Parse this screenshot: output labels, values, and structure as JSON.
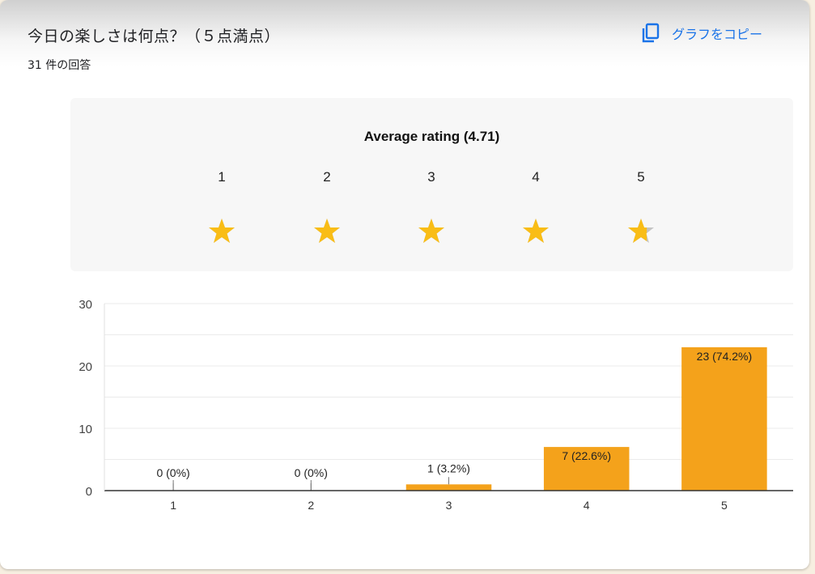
{
  "header": {
    "title": "今日の楽しさは何点？（５点満点）",
    "response_count": "31 件の回答",
    "copy_label": "グラフをコピー"
  },
  "rating": {
    "average_label": "Average rating (4.71)",
    "average_value": 4.71,
    "stars": [
      {
        "label": "1",
        "fill": 1
      },
      {
        "label": "2",
        "fill": 1
      },
      {
        "label": "3",
        "fill": 1
      },
      {
        "label": "4",
        "fill": 1
      },
      {
        "label": "5",
        "fill": 0.71
      }
    ]
  },
  "colors": {
    "star_filled": "#f9bd16",
    "star_empty": "#c4c4c4",
    "bar": "#f4a21b",
    "accent": "#1a73e8"
  },
  "icons": {
    "copy": "copy-icon",
    "star": "star-icon"
  },
  "chart_data": {
    "type": "bar",
    "categories": [
      "1",
      "2",
      "3",
      "4",
      "5"
    ],
    "values": [
      0,
      0,
      1,
      7,
      23
    ],
    "data_labels": [
      "0 (0%)",
      "0 (0%)",
      "1 (3.2%)",
      "7 (22.6%)",
      "23 (74.2%)"
    ],
    "y_ticks": [
      0,
      10,
      20,
      30
    ],
    "ylim": [
      0,
      30
    ],
    "grid": true
  }
}
